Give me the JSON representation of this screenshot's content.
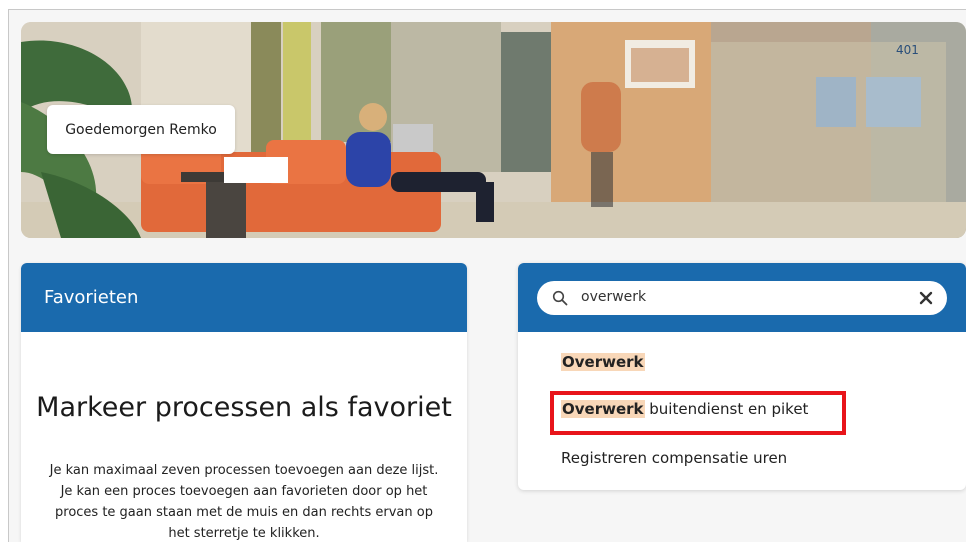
{
  "hero": {
    "greeting": "Goedemorgen Remko",
    "room_number": "401"
  },
  "favorites": {
    "header": "Favorieten",
    "title": "Markeer processen als favoriet",
    "description": "Je kan maximaal zeven processen toevoegen aan deze lijst. Je kan een proces toevoegen aan favorieten door op het proces te gaan staan met de muis en dan rechts ervan op het sterretje te klikken."
  },
  "search": {
    "value": "overwerk",
    "results": [
      {
        "match": "Overwerk",
        "rest": ""
      },
      {
        "match": "Overwerk",
        "rest": " buitendienst en piket"
      },
      {
        "match": "",
        "rest": "Registreren compensatie uren"
      }
    ]
  },
  "colors": {
    "brand_blue": "#1a6aad",
    "highlight": "#f8d7b8",
    "annotation_red": "#e8141a"
  }
}
